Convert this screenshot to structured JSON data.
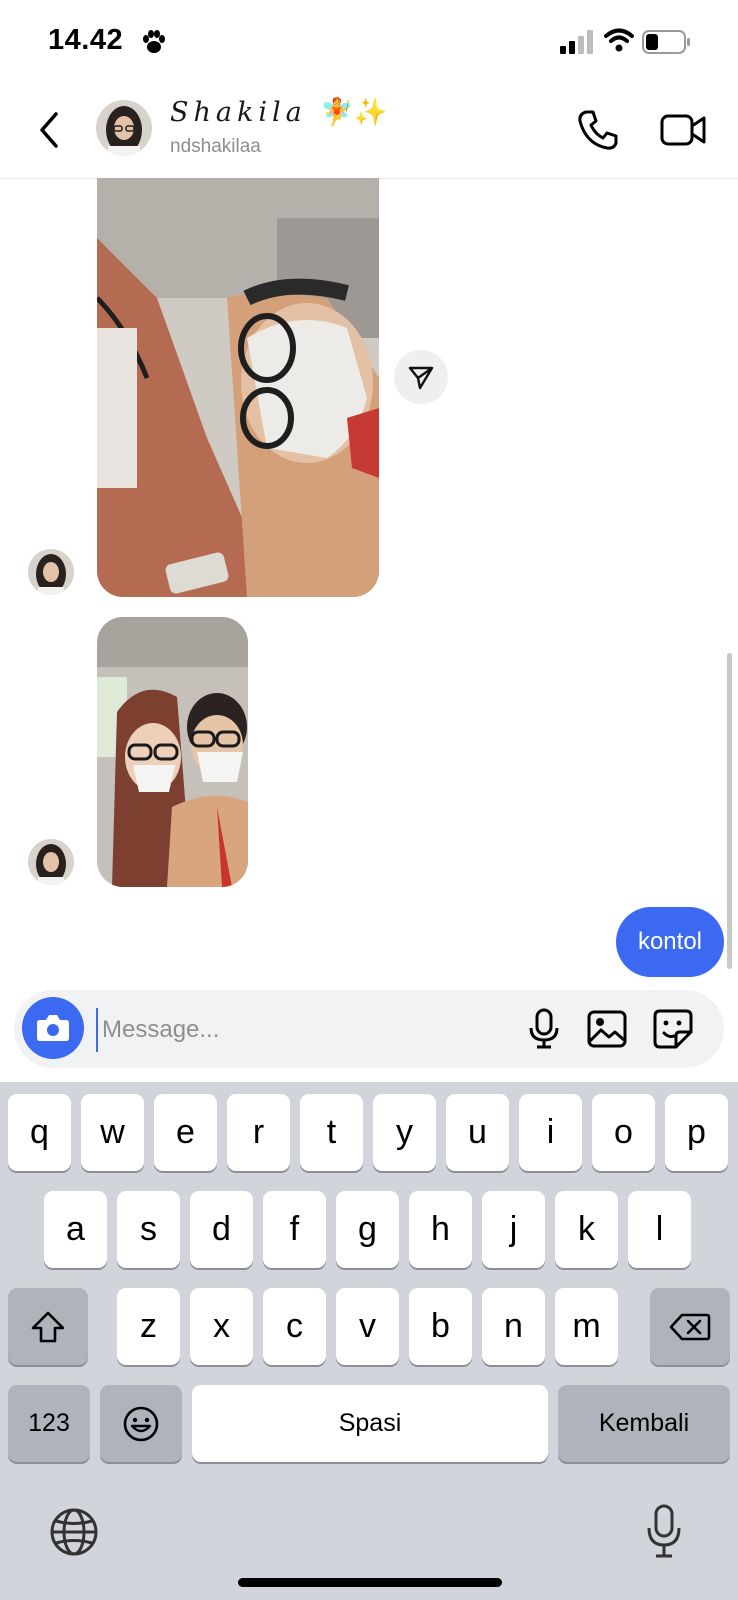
{
  "status_bar": {
    "time": "14.42",
    "paw_icon": "paw-icon",
    "signal": "signal-icon",
    "wifi": "wifi-icon",
    "battery": "battery-icon"
  },
  "header": {
    "display_name": "Shakila",
    "name_emoji": "🧚✨",
    "username": "ndshakilaa",
    "icons": [
      "chevron-left-icon",
      "phone-icon",
      "video-icon"
    ]
  },
  "messages": [
    {
      "type": "photo",
      "from": "them",
      "description_icon": "photo"
    },
    {
      "type": "photo",
      "from": "them",
      "description_icon": "photo"
    },
    {
      "type": "text",
      "from": "me",
      "text": "kontol"
    }
  ],
  "composer": {
    "placeholder": "Message...",
    "icons": [
      "camera-icon",
      "mic-icon",
      "gallery-icon",
      "sticker-icon"
    ]
  },
  "keyboard": {
    "row1": [
      "q",
      "w",
      "e",
      "r",
      "t",
      "y",
      "u",
      "i",
      "o",
      "p"
    ],
    "row2": [
      "a",
      "s",
      "d",
      "f",
      "g",
      "h",
      "j",
      "k",
      "l"
    ],
    "row3": [
      "z",
      "x",
      "c",
      "v",
      "b",
      "n",
      "m"
    ],
    "numbers_label": "123",
    "space_label": "Spasi",
    "return_label": "Kembali"
  },
  "colors": {
    "accent": "#3b69f2",
    "keyboard_bg": "#d1d4da",
    "key_dark": "#aeb3bc"
  }
}
